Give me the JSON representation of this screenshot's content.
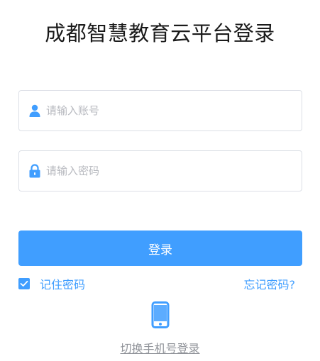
{
  "title": "成都智慧教育云平台登录",
  "form": {
    "account": {
      "placeholder": "请输入账号",
      "value": "",
      "icon": "user-icon"
    },
    "password": {
      "placeholder": "请输入密码",
      "value": "",
      "icon": "lock-icon"
    },
    "login_label": "登录",
    "remember_label": "记住密码",
    "remember_checked": true,
    "forgot_label": "忘记密码?"
  },
  "alt_login": {
    "icon": "mobile-phone-icon",
    "label": "切换手机号登录"
  },
  "colors": {
    "accent": "#409eff",
    "border": "#dcdfe6",
    "placeholder": "#b7b9bf",
    "muted_link": "#909399"
  }
}
